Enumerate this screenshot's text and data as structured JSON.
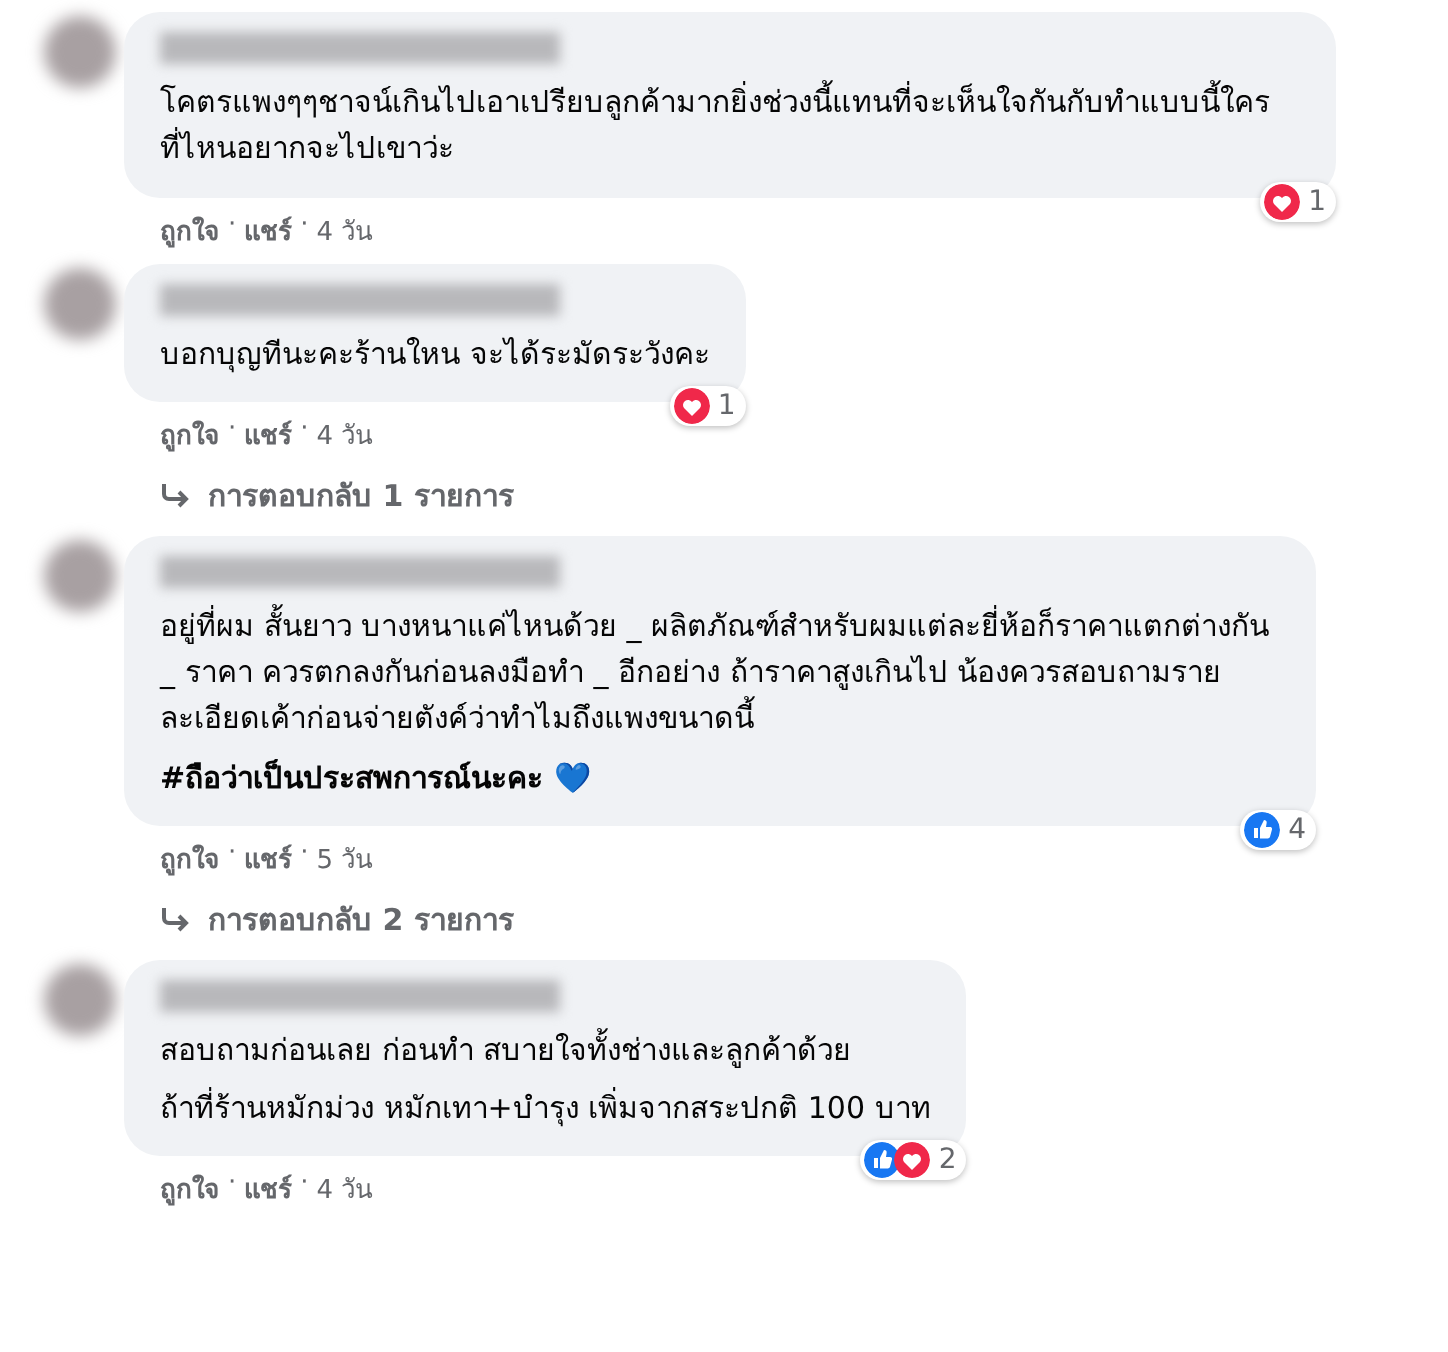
{
  "comments": [
    {
      "paragraphs": [
        {
          "kind": "text",
          "text": "โคตรแพงๆๆชาจน์เกินไปเอาเปรียบลูกค้ามากยิ่งช่วงนี้แทนที่จะเห็นใจกันกับทำแบบนี้ใครที่ไหนอยากจะไปเขาว่ะ"
        }
      ],
      "reactions": [
        {
          "kind": "love"
        }
      ],
      "reaction_count": "1",
      "meta": [
        {
          "kind": "link",
          "text": "ถูกใจ"
        },
        {
          "kind": "sep",
          "text": "·"
        },
        {
          "kind": "link",
          "text": "แชร์"
        },
        {
          "kind": "sep",
          "text": "·"
        },
        {
          "kind": "time",
          "text": "4 วัน"
        }
      ]
    },
    {
      "paragraphs": [
        {
          "kind": "text",
          "text": "บอกบุญทีนะคะร้านใหน จะได้ระมัดระวังคะ"
        }
      ],
      "reactions": [
        {
          "kind": "love"
        }
      ],
      "reaction_count": "1",
      "meta": [
        {
          "kind": "link",
          "text": "ถูกใจ"
        },
        {
          "kind": "sep",
          "text": "·"
        },
        {
          "kind": "link",
          "text": "แชร์"
        },
        {
          "kind": "sep",
          "text": "·"
        },
        {
          "kind": "time",
          "text": "4 วัน"
        }
      ],
      "replies": "การตอบกลับ 1 รายการ"
    },
    {
      "paragraphs": [
        {
          "kind": "text",
          "text": "อยู่ที่ผม สั้นยาว บางหนาแค่ไหนด้วย _ ผลิตภัณฑ์สำหรับผมแต่ละยี่ห้อก็ราคาแตกต่างกัน _ ราคา ควรตกลงกันก่อนลงมือทำ _ อีกอย่าง ถ้าราคาสูงเกินไป น้องควรสอบถามรายละเอียดเค้าก่อนจ่ายตังค์ว่าทำไมถึงแพงขนาดนี้"
        },
        {
          "kind": "hashtag",
          "text": "#ถือว่าเป็นประสพการณ์นะคะ 💙"
        }
      ],
      "reactions": [
        {
          "kind": "like"
        }
      ],
      "reaction_count": "4",
      "meta": [
        {
          "kind": "link",
          "text": "ถูกใจ"
        },
        {
          "kind": "sep",
          "text": "·"
        },
        {
          "kind": "link",
          "text": "แชร์"
        },
        {
          "kind": "sep",
          "text": "·"
        },
        {
          "kind": "time",
          "text": "5 วัน"
        }
      ],
      "replies": "การตอบกลับ 2 รายการ"
    },
    {
      "paragraphs": [
        {
          "kind": "text",
          "text": "สอบถามก่อนเลย ก่อนทำ สบายใจทั้งช่างและลูกค้าด้วย"
        },
        {
          "kind": "text",
          "text": "ถ้าที่ร้านหมักม่วง หมักเทา+บำรุง เพิ่มจากสระปกติ 100 บาท"
        }
      ],
      "reactions": [
        {
          "kind": "like"
        },
        {
          "kind": "love"
        }
      ],
      "reaction_count": "2",
      "meta": [
        {
          "kind": "link",
          "text": "ถูกใจ"
        },
        {
          "kind": "sep",
          "text": "·"
        },
        {
          "kind": "link",
          "text": "แชร์"
        },
        {
          "kind": "sep",
          "text": "·"
        },
        {
          "kind": "time",
          "text": "4 วัน"
        }
      ]
    }
  ]
}
